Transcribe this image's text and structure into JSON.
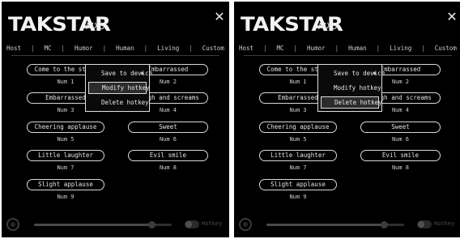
{
  "app": {
    "brand": "TAKSTAR",
    "model": "MX3",
    "close_glyph": "✕"
  },
  "tabs": [
    "Host",
    "MC",
    "Humor",
    "Human",
    "Living",
    "Custom"
  ],
  "tab_separator": "|",
  "hotkeys": [
    {
      "label": "Come to the stage",
      "key": "Num 1"
    },
    {
      "label": "Embarrassed",
      "key": "Num 2"
    },
    {
      "label": "Embarrassed",
      "key": "Num 3"
    },
    {
      "label": "Laugh and screams",
      "key": "Num 4"
    },
    {
      "label": "Cheering applause",
      "key": "Num 5"
    },
    {
      "label": "Sweet",
      "key": "Num 6"
    },
    {
      "label": "Little laughter",
      "key": "Num 7"
    },
    {
      "label": "Evil smile",
      "key": "Num 8"
    },
    {
      "label": "Slight applause",
      "key": "Num 9"
    }
  ],
  "context_menu": {
    "items": [
      {
        "label": "Save to device",
        "submenu_glyph": "▶"
      },
      {
        "label": "Modify hotkey"
      },
      {
        "label": "Delete hotkey"
      }
    ]
  },
  "panels": [
    {
      "highlighted_item": 1
    },
    {
      "highlighted_item": 2
    }
  ],
  "bottom_bar": {
    "volume_level": 0.85,
    "toggle_label": "Hotkey",
    "play_icon": "play-icon"
  },
  "colors": {
    "background": "#000000",
    "border": "#d8d8d8",
    "text": "#e2e2e2",
    "menu_highlight": "#2c2c2c"
  }
}
